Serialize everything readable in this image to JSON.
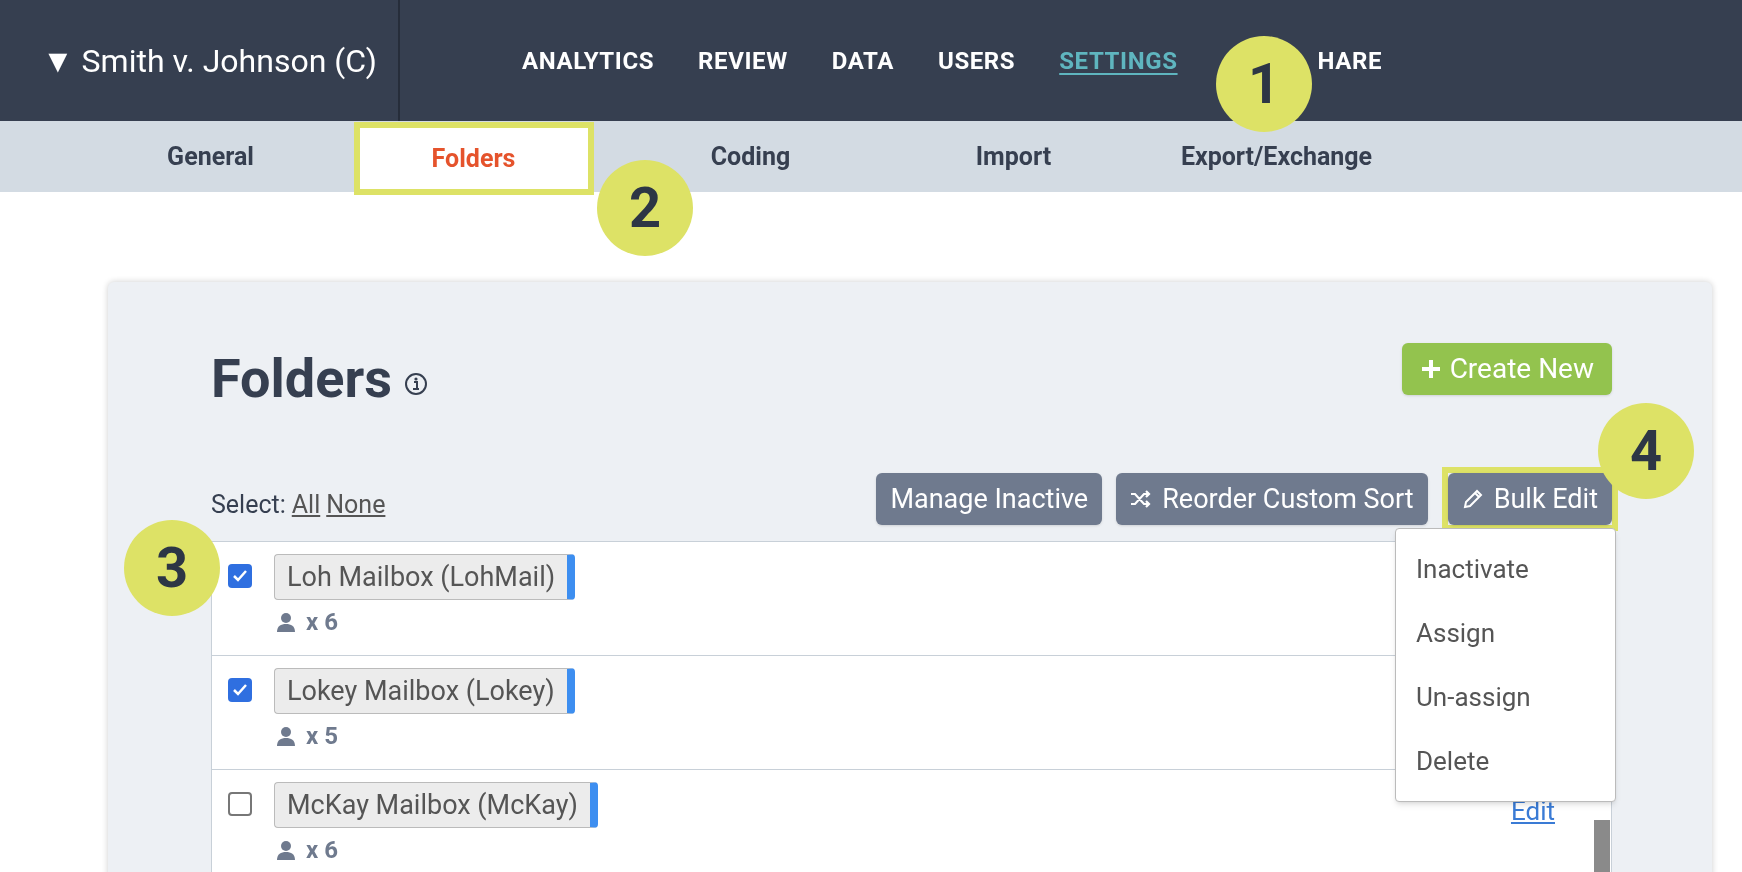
{
  "project": {
    "title": "▼ Smith v. Johnson (C)"
  },
  "nav": [
    {
      "label": "ANALYTICS",
      "selected": false
    },
    {
      "label": "REVIEW",
      "selected": false
    },
    {
      "label": "DATA",
      "selected": false
    },
    {
      "label": "USERS",
      "selected": false
    },
    {
      "label": "SETTINGS",
      "selected": true
    },
    {
      "label": "HARE",
      "selected": false
    }
  ],
  "subtabs": [
    {
      "label": "General",
      "selected": false
    },
    {
      "label": "Folders",
      "selected": true
    },
    {
      "label": "Coding",
      "selected": false
    },
    {
      "label": "Import",
      "selected": false
    },
    {
      "label": "Export/Exchange",
      "selected": false
    }
  ],
  "panel": {
    "title": "Folders",
    "create_button": "Create New",
    "select_label": "Select:",
    "select_all": "All",
    "select_none": "None",
    "actions": [
      {
        "label": "Manage Inactive",
        "kind": "plain"
      },
      {
        "label": "Reorder Custom Sort",
        "kind": "shuffle"
      },
      {
        "label": "Bulk Edit",
        "kind": "pencil"
      }
    ],
    "folders": [
      {
        "name": "Loh Mailbox (LohMail)",
        "users": "x 6",
        "checked": true
      },
      {
        "name": "Lokey Mailbox (Lokey)",
        "users": "x 5",
        "checked": true
      },
      {
        "name": "McKay Mailbox (McKay)",
        "users": "x 6",
        "checked": false,
        "edit": "Edit"
      }
    ],
    "bulk_menu": [
      "Inactivate",
      "Assign",
      "Un-assign",
      "Delete"
    ]
  },
  "callouts": [
    "1",
    "2",
    "3",
    "4"
  ]
}
